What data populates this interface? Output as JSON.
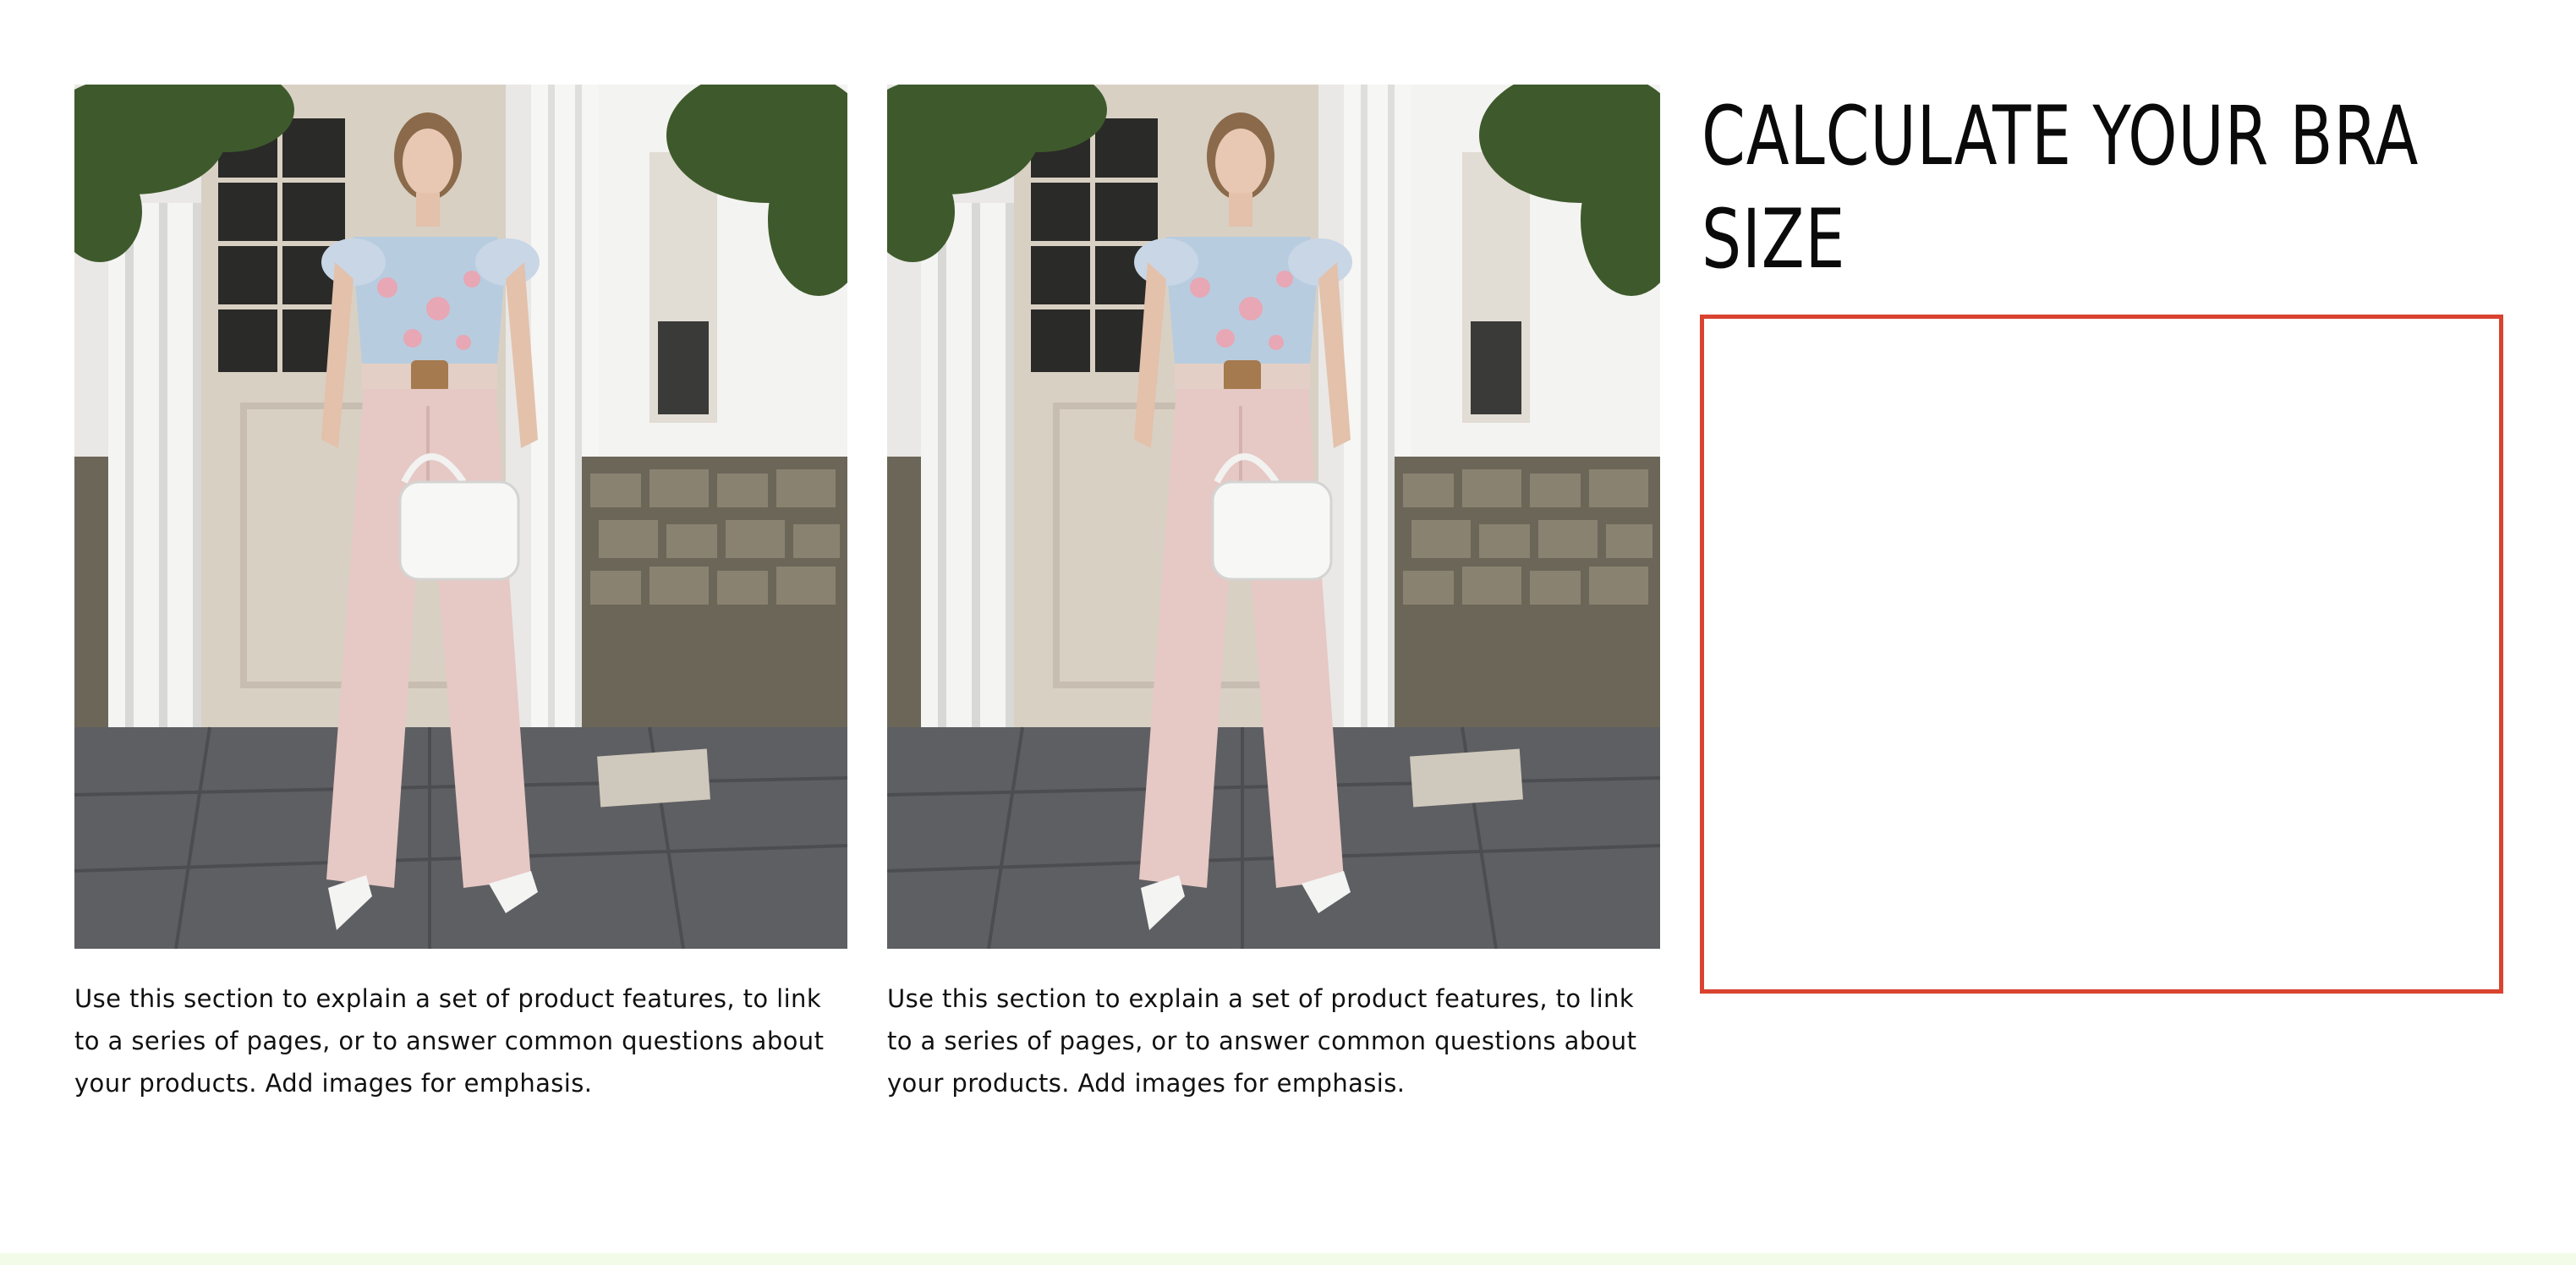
{
  "features": [
    {
      "image_alt": "Woman in floral top, pink wide-leg trousers and white heels holding a white handbag in front of a door",
      "text": "Use this section to explain a set of product features, to link to a series of pages, or to answer common questions about your products. Add images for emphasis."
    },
    {
      "image_alt": "Woman in floral top, pink wide-leg trousers and white heels holding a white handbag in front of a door",
      "text": "Use this section to explain a set of product features, to link to a series of pages, or to answer common questions about your products. Add images for emphasis."
    }
  ],
  "calculator": {
    "title": "CALCULATE YOUR BRA SIZE",
    "frame_color": "#d9432f"
  },
  "colors": {
    "background": "#ffffff",
    "footer_strip": "#f2fbe8"
  }
}
